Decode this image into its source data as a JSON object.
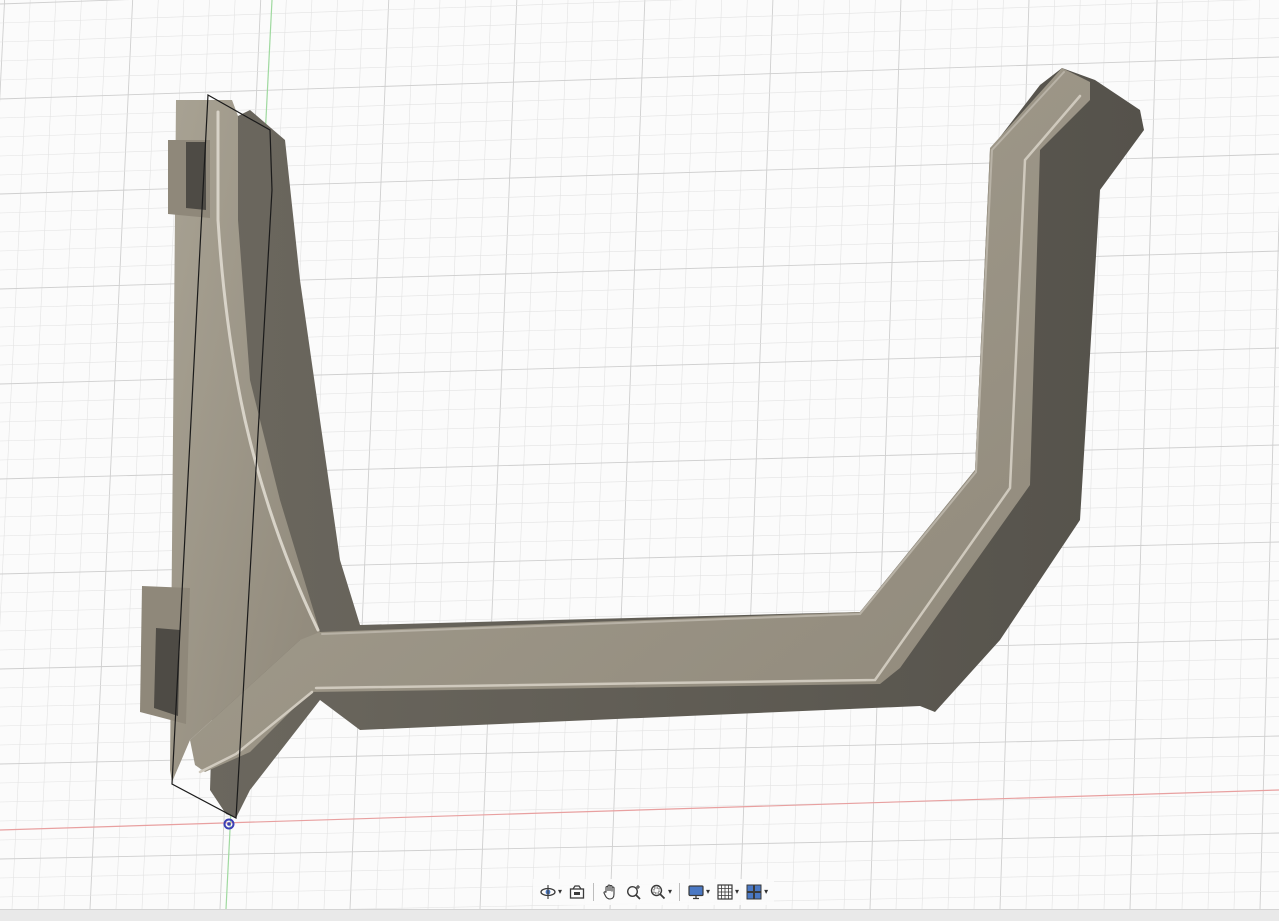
{
  "viewport": {
    "background": "#fbfbfb",
    "grid_minor_color": "#e3e3e3",
    "grid_major_color": "#cfcfcf",
    "x_axis_color": "#e8a0a0",
    "y_axis_color": "#9fd99f"
  },
  "model": {
    "name": "bracket-body",
    "face_color": "#9a9384",
    "side_color": "#5e5a52",
    "highlight_color": "#d8d3c8",
    "sketch_outline_color": "#1a1a1a",
    "origin_point_color": "#3b3fb4"
  },
  "navigation_bar": {
    "tools": [
      {
        "name": "orbit-tool",
        "icon": "orbit-icon",
        "has_dropdown": true
      },
      {
        "name": "look-at-tool",
        "icon": "look-at-icon",
        "has_dropdown": false
      },
      {
        "name": "pan-tool",
        "icon": "hand-icon",
        "has_dropdown": false
      },
      {
        "name": "zoom-tool",
        "icon": "zoom-icon",
        "has_dropdown": false
      },
      {
        "name": "fit-tool",
        "icon": "zoom-window-icon",
        "has_dropdown": true
      },
      {
        "name": "display-settings-tool",
        "icon": "monitor-icon",
        "has_dropdown": true
      },
      {
        "name": "grid-snaps-tool",
        "icon": "grid-icon",
        "has_dropdown": true
      },
      {
        "name": "viewports-tool",
        "icon": "viewports-icon",
        "has_dropdown": true
      }
    ]
  }
}
